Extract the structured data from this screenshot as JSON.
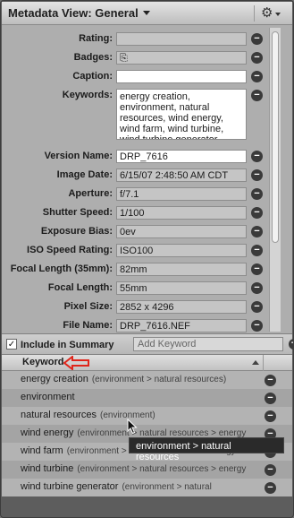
{
  "window": {
    "title": "Metadata View: General"
  },
  "fields": [
    {
      "label": "Rating:",
      "value": "",
      "style": "gray"
    },
    {
      "label": "Badges:",
      "value": "⎘",
      "style": "gray"
    },
    {
      "label": "Caption:",
      "value": "",
      "style": "white"
    },
    {
      "label": "Keywords:",
      "value": "energy creation, environment, natural resources, wind energy, wind farm, wind turbine, wind turbine generator",
      "style": "kw"
    },
    {
      "label": "Version Name:",
      "value": "DRP_7616",
      "style": "white"
    },
    {
      "label": "Image Date:",
      "value": "6/15/07 2:48:50 AM CDT",
      "style": "gray"
    },
    {
      "label": "Aperture:",
      "value": "f/7.1",
      "style": "gray"
    },
    {
      "label": "Shutter Speed:",
      "value": "1/100",
      "style": "gray"
    },
    {
      "label": "Exposure Bias:",
      "value": "0ev",
      "style": "gray"
    },
    {
      "label": "ISO Speed Rating:",
      "value": "ISO100",
      "style": "gray"
    },
    {
      "label": "Focal Length (35mm):",
      "value": "82mm",
      "style": "gray"
    },
    {
      "label": "Focal Length:",
      "value": "55mm",
      "style": "gray"
    },
    {
      "label": "Pixel Size:",
      "value": "2852 x 4296",
      "style": "gray"
    },
    {
      "label": "File Name:",
      "value": "DRP_7616.NEF",
      "style": "gray"
    }
  ],
  "summary": {
    "checkbox_label": "Include in Summary",
    "checked_mark": "✓",
    "add_keyword_placeholder": "Add Keyword",
    "plus": "+"
  },
  "keyword_table": {
    "header": "Keyword",
    "rows": [
      {
        "name": "energy creation",
        "path": "(environment > natural resources)"
      },
      {
        "name": "environment",
        "path": ""
      },
      {
        "name": "natural resources",
        "path": "(environment)"
      },
      {
        "name": "wind energy",
        "path": "(environment > natural resources > energy"
      },
      {
        "name": "wind farm",
        "path": "(environment > natural resources > energy"
      },
      {
        "name": "wind turbine",
        "path": "(environment > natural resources > energy"
      },
      {
        "name": "wind turbine generator",
        "path": "(environment > natural"
      }
    ]
  },
  "tooltip": "environment > natural resources",
  "icons": {
    "gear": "gear-icon",
    "minus": "remove-icon",
    "arrow": "red-arrow-annotation"
  }
}
